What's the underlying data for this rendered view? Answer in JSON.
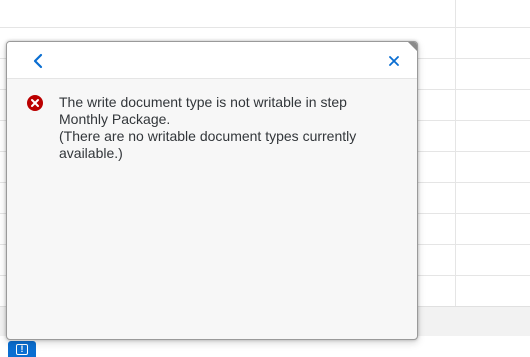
{
  "popover": {
    "message": {
      "type": "error",
      "title": "The write document type is not writable in step Monthly Package.",
      "description": "(There are no writable document types currently available.)"
    }
  },
  "colors": {
    "error": "#bb0000",
    "accent": "#0a6ed1",
    "text": "#32363a"
  },
  "icons": {
    "back": "chevron-left-icon",
    "close": "close-icon",
    "error": "error-icon",
    "message_indicator": "message-popup-icon"
  },
  "footer": {
    "message_indicator_glyph": "!"
  }
}
